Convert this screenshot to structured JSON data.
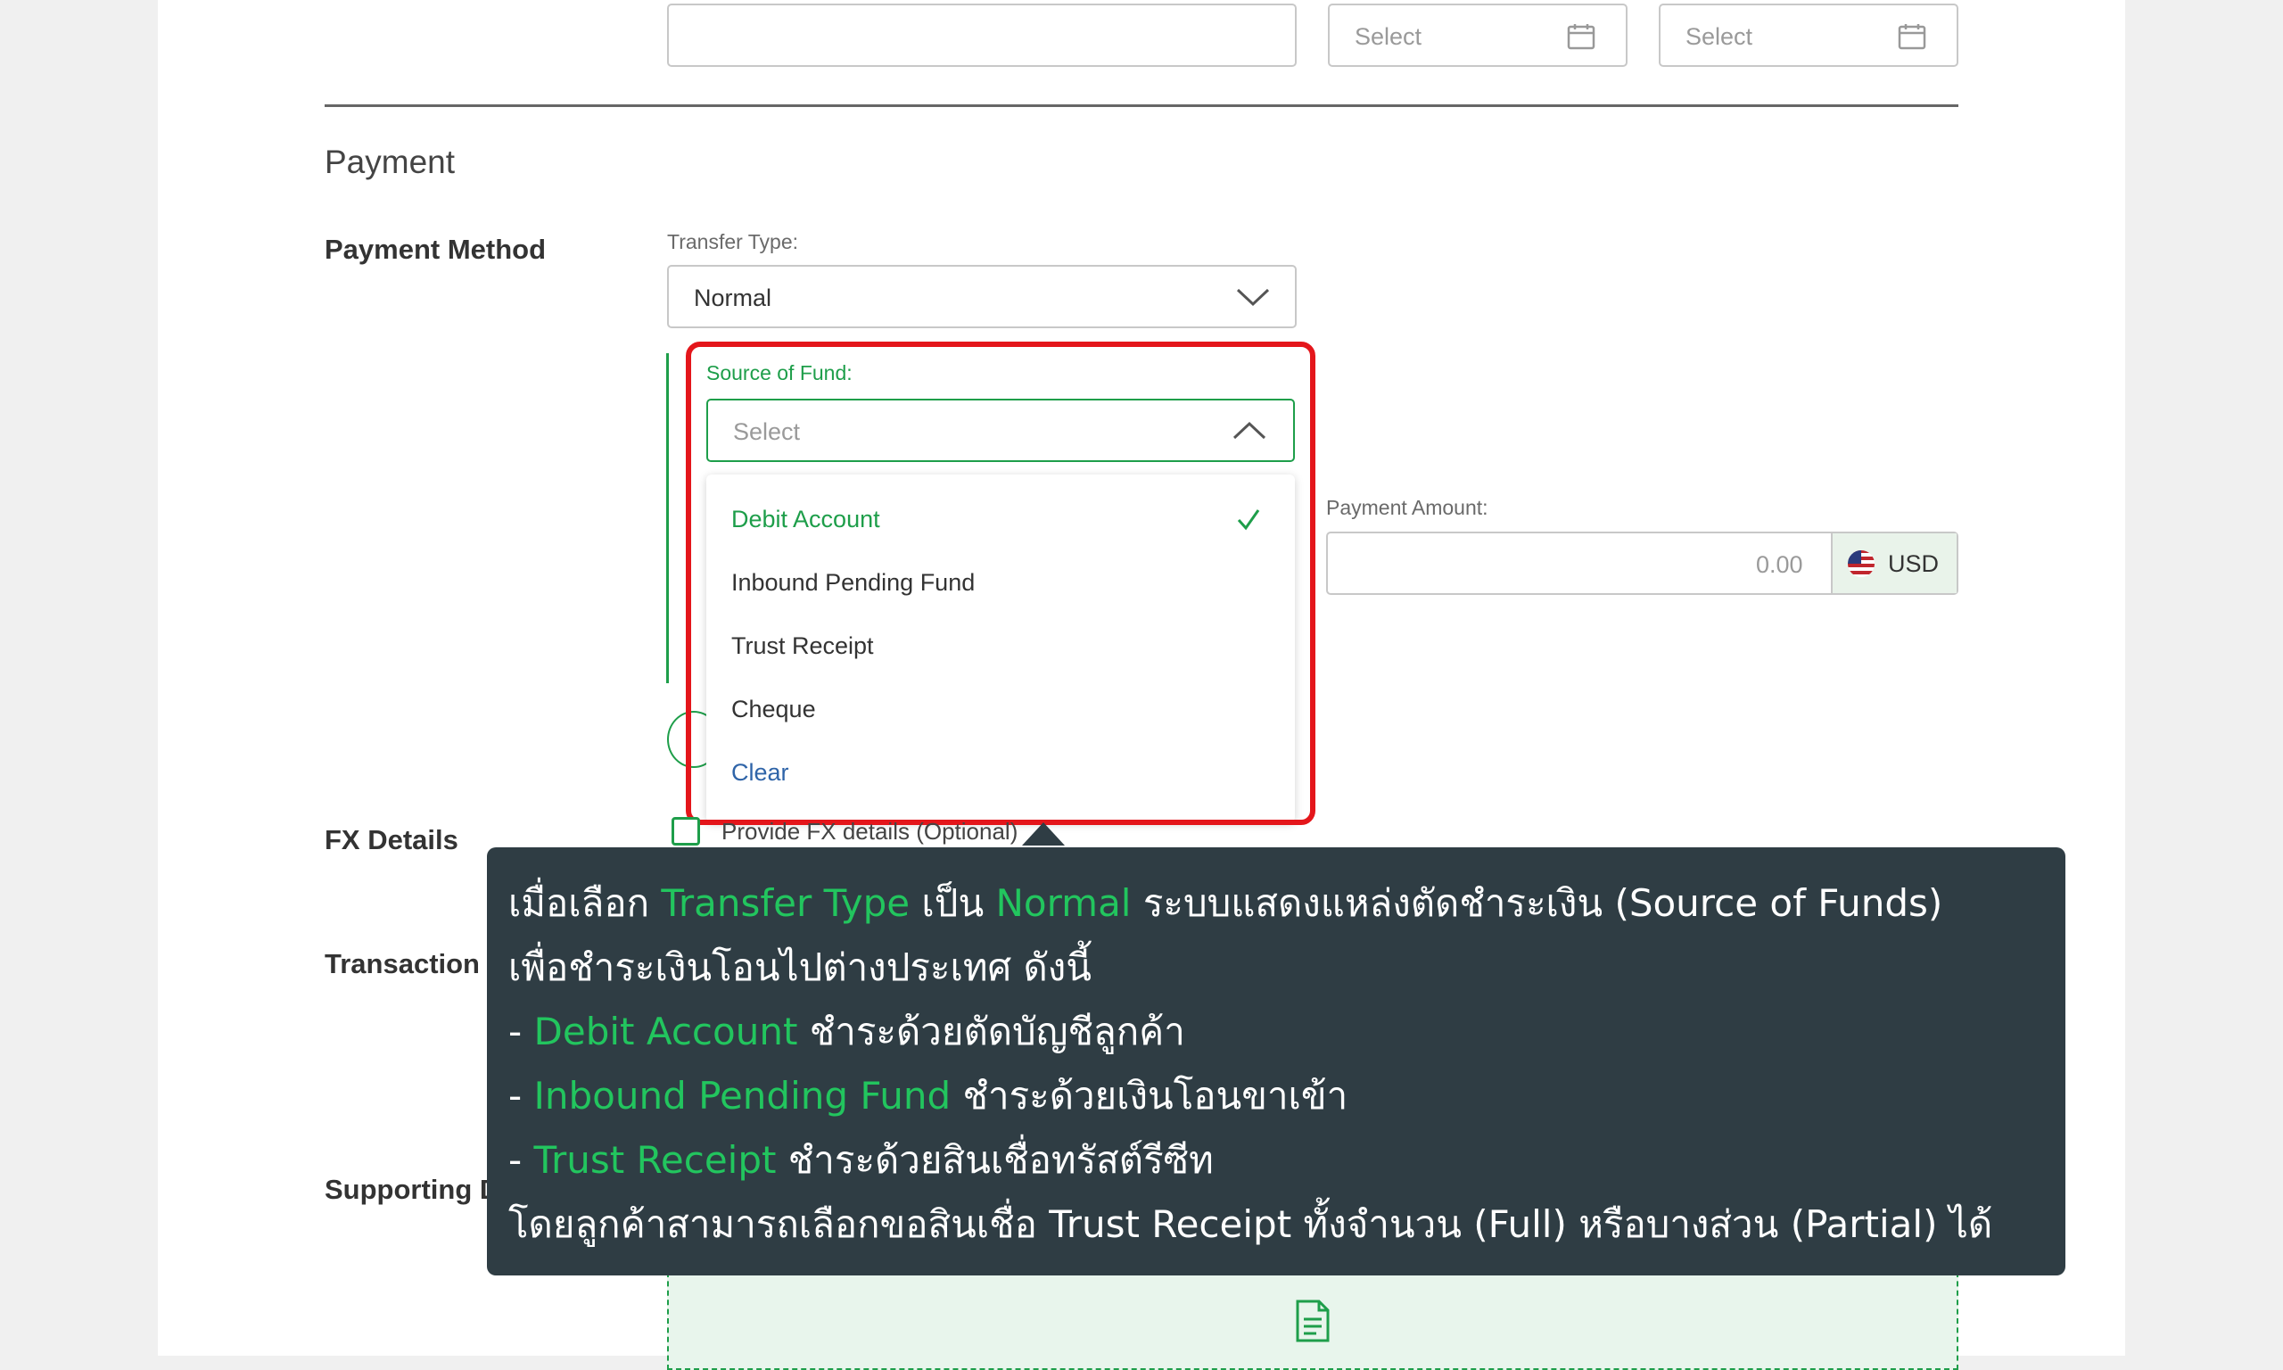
{
  "top_row": {
    "date_from_placeholder": "Select",
    "date_to_placeholder": "Select"
  },
  "payment": {
    "section_title": "Payment",
    "method_label": "Payment Method",
    "transfer_type_label": "Transfer Type:",
    "transfer_type_value": "Normal",
    "source_of_fund_label": "Source of Fund:",
    "source_of_fund_placeholder": "Select",
    "options": [
      "Debit Account",
      "Inbound Pending Fund",
      "Trust Receipt",
      "Cheque"
    ],
    "selected_option": "Debit Account",
    "clear_label": "Clear",
    "amount_label": "Payment Amount:",
    "amount_value": "0.00",
    "currency": "USD"
  },
  "fx": {
    "label": "FX Details",
    "checkbox_label": "Provide FX details (Optional)"
  },
  "left_labels": {
    "transaction": "Transaction",
    "supporting": "Supporting D"
  },
  "tooltip": {
    "line1": [
      {
        "t": "เมื่อเลือก ",
        "hl": false
      },
      {
        "t": "Transfer Type",
        "hl": true
      },
      {
        "t": " เป็น ",
        "hl": false
      },
      {
        "t": "Normal",
        "hl": true
      },
      {
        "t": " ระบบแสดงแหล่งตัดชำระเงิน (Source of Funds)",
        "hl": false
      }
    ],
    "line2": [
      {
        "t": "เพื่อชำระเงินโอนไปต่างประเทศ ดังนี้",
        "hl": false
      }
    ],
    "line3": [
      {
        "t": "- ",
        "hl": false
      },
      {
        "t": "Debit Account",
        "hl": true
      },
      {
        "t": " ชำระด้วยตัดบัญชีลูกค้า",
        "hl": false
      }
    ],
    "line4": [
      {
        "t": "- ",
        "hl": false
      },
      {
        "t": "Inbound Pending Fund",
        "hl": true
      },
      {
        "t": " ชำระด้วยเงินโอนขาเข้า",
        "hl": false
      }
    ],
    "line5": [
      {
        "t": "- ",
        "hl": false
      },
      {
        "t": "Trust Receipt",
        "hl": true
      },
      {
        "t": " ชำระด้วยสินเชื่อทรัสต์รีซีท",
        "hl": false
      }
    ],
    "line6": [
      {
        "t": "โดยลูกค้าสามารถเลือกขอสินเชื่อ Trust Receipt ทั้งจำนวน (Full) หรือบางส่วน (Partial) ได้",
        "hl": false
      }
    ]
  },
  "colors": {
    "accent_green": "#1e9e4a",
    "highlight_red": "#e4161b",
    "tooltip_bg": "#2f3d44",
    "link_blue": "#2f64a8"
  }
}
